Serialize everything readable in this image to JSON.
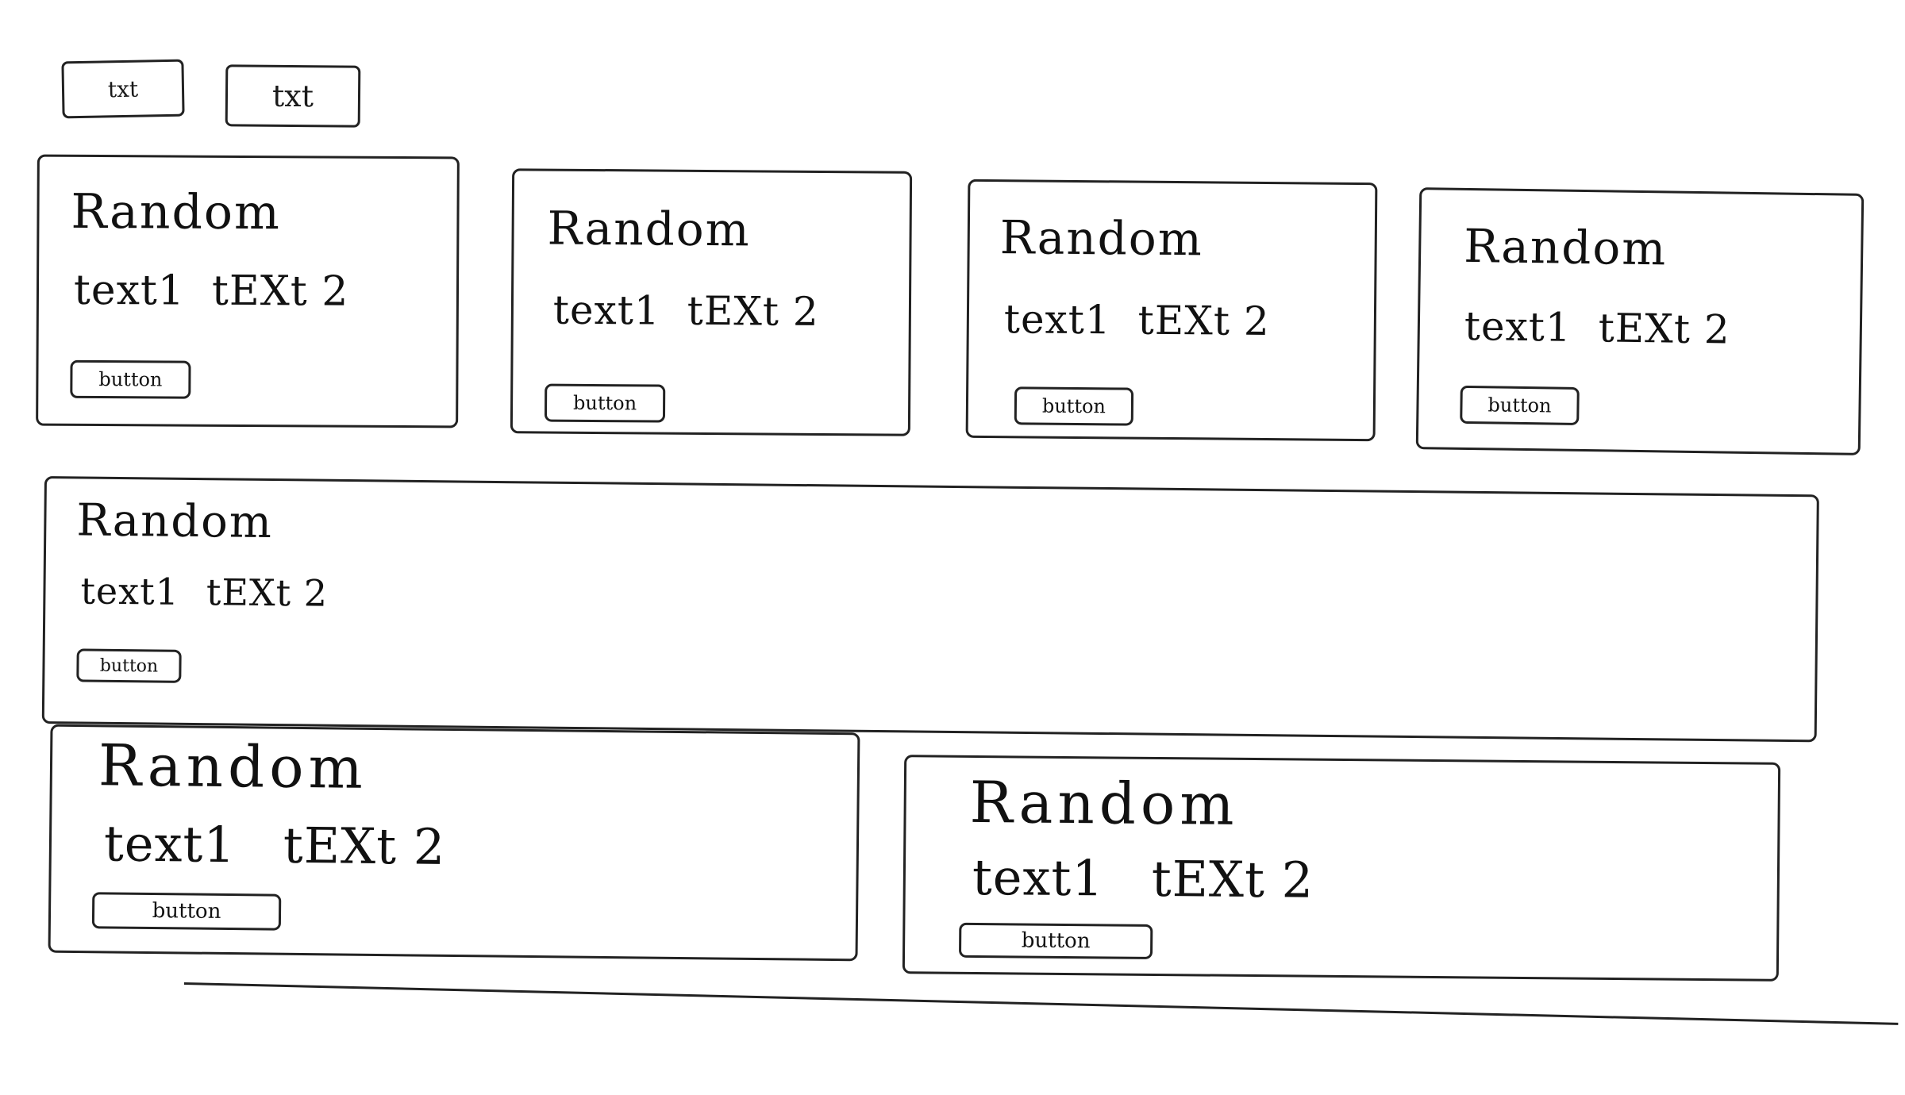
{
  "top_buttons": [
    "txt",
    "txt"
  ],
  "cards": [
    {
      "title": "Random",
      "text1": "text1",
      "text2": "tEXt 2",
      "button": "button"
    },
    {
      "title": "Random",
      "text1": "text1",
      "text2": "tEXt 2",
      "button": "button"
    },
    {
      "title": "Random",
      "text1": "text1",
      "text2": "tEXt 2",
      "button": "button"
    },
    {
      "title": "Random",
      "text1": "text1",
      "text2": "tEXt 2",
      "button": "button"
    },
    {
      "title": "Random",
      "text1": "text1",
      "text2": "tEXt 2",
      "button": "button"
    },
    {
      "title": "Random",
      "text1": "text1",
      "text2": "tEXt 2",
      "button": "button"
    },
    {
      "title": "Random",
      "text1": "text1",
      "text2": "tEXt 2",
      "button": "button"
    }
  ]
}
